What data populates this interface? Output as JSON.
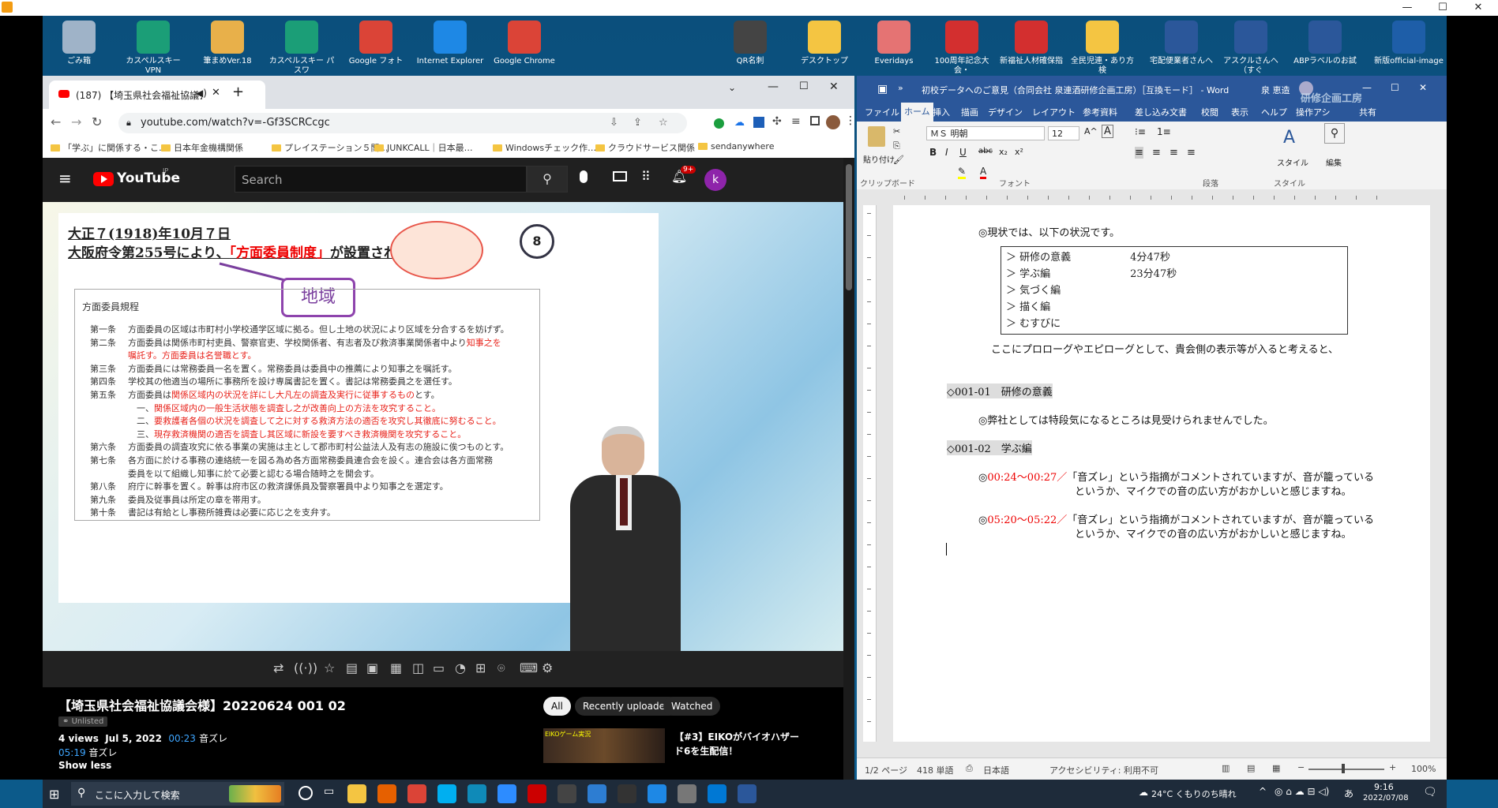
{
  "desktop_icons": [
    {
      "label": "ごみ箱",
      "icon": "recycle-bin-icon",
      "color": "#9fb3c8"
    },
    {
      "label": "カスペルスキー VPN",
      "icon": "vpn-shield-icon",
      "color": "#1b9e77"
    },
    {
      "label": "筆まめVer.18",
      "icon": "fude-document-icon",
      "color": "#e8b04a"
    },
    {
      "label": "カスペルスキー パスワ",
      "icon": "password-shield-icon",
      "color": "#1b9e77"
    },
    {
      "label": "Google フォト",
      "icon": "chrome-icon",
      "color": "#db4437"
    },
    {
      "label": "Internet Explorer",
      "icon": "ie-icon",
      "color": "#1e88e5"
    },
    {
      "label": "Google Chrome",
      "icon": "chrome-icon",
      "color": "#db4437"
    },
    {
      "label": "QR名刺",
      "icon": "qr-code-icon",
      "color": "#444"
    },
    {
      "label": "デスクトップ",
      "icon": "folder-icon",
      "color": "#f4c542"
    },
    {
      "label": "Everidays",
      "icon": "everidays-icon",
      "color": "#e57373"
    },
    {
      "label": "100周年記念大会・",
      "icon": "pdf-icon",
      "color": "#d32f2f"
    },
    {
      "label": "新福祉人材確保指",
      "icon": "pdf-icon",
      "color": "#d32f2f"
    },
    {
      "label": "全民児連・あり方検",
      "icon": "document-icon",
      "color": "#f4c542"
    },
    {
      "label": "宅配便業者さんへ",
      "icon": "word-doc-icon",
      "color": "#2b579a"
    },
    {
      "label": "アスクルさんへ（すぐ",
      "icon": "word-doc-icon",
      "color": "#2b579a"
    },
    {
      "label": "ABPラベルのお試",
      "icon": "word-doc-icon",
      "color": "#2b579a"
    },
    {
      "label": "新版official-image",
      "icon": "image-icon",
      "color": "#1e5ea8"
    }
  ],
  "chrome": {
    "tab_title": "(187) 【埼玉県社会福祉協議会",
    "url": "youtube.com/watch?v=-Gf3SCRCcgc",
    "bookmarks": [
      "「学ぶ」に関係する・こ…",
      "日本年金機構関係",
      "プレイステーション５関…",
      "JUNKCALL｜日本最…",
      "Windowsチェック作…",
      "クラウドサービス関係",
      "sendanywhere"
    ],
    "youtube": {
      "logo": "YouTube",
      "region": "JP",
      "search_placeholder": "Search",
      "notif_count": "9+",
      "avatar_letter": "k"
    },
    "slide": {
      "line1": "大正７(1918)年10月７日",
      "line2_pre": "大阪府令第255号により、",
      "line2_red": "「方面委員制度」",
      "line2_post": "が設置された日",
      "badge": "地域",
      "number": "8",
      "box_title": "方面委員規程",
      "articles": [
        {
          "head": "第一条",
          "text": "方面委員の区域は市町村小学校通学区域に拠る。但し土地の状況により区域を分合するを妨げず。"
        },
        {
          "head": "第二条",
          "text": "方面委員は関係市町村吏員、警察官吏、学校関係者、有志者及び救済事業関係者中より",
          "red": "知事之を"
        },
        {
          "head": "",
          "text": "",
          "red": "嘱託す。方面委員は名誉職とす。"
        },
        {
          "head": "第三条",
          "text": "方面委員には常務委員一名を置く。常務委員は委員中の推薦により知事之を嘱託す。"
        },
        {
          "head": "第四条",
          "text": "学校其の他適当の場所に事務所を設け専属書記を置く。書記は常務委員之を選任す。"
        },
        {
          "head": "第五条",
          "text": "方面委員は",
          "red": "関係区域内の状況を詳にし大凡左の調査及実行に従事するもの",
          "tail": "とす。"
        },
        {
          "head": "",
          "text": "　一、",
          "red": "関係区域内の一般生活状態を調査し之が改善向上の方法を攻究すること。"
        },
        {
          "head": "",
          "text": "　二、",
          "red": "要救護者各個の状況を調査して之に対する救済方法の適否を攻究し其徹底に努むること。"
        },
        {
          "head": "",
          "text": "　三、",
          "red": "現存救済機関の適否を調査し其区域に新設を要すべき救済機関を攻究すること。"
        },
        {
          "head": "第六条",
          "text": "方面委員の調査攻究に依る事業の実施は主として郡市町村公益法人及有志の施設に俟つものとす。"
        },
        {
          "head": "第七条",
          "text": "各方面に於ける事務の連絡統一を図る為め各方面常務委員連合会を設く。連合会は各方面常務"
        },
        {
          "head": "",
          "text": "委員を以て組織し知事に於て必要と認むる場合随時之を開会す。"
        },
        {
          "head": "第八条",
          "text": "府庁に幹事を置く。幹事は府市区の救済課係員及警察署員中より知事之を選定す。"
        },
        {
          "head": "第九条",
          "text": "委員及従事員は所定の章を帯用す。"
        },
        {
          "head": "第十条",
          "text": "書記は有給とし事務所雑費は必要に応じ之を支弁す。"
        }
      ]
    },
    "video_info": {
      "title": "【埼玉県社会福祉協議会様】20220624 001 02",
      "visibility": "Unlisted",
      "views": "4 views",
      "date": "Jul 5, 2022",
      "ts1": "00:23",
      "ts1_text": "音ズレ",
      "ts2": "05:19",
      "ts2_text": "音ズレ",
      "show_less": "Show less"
    },
    "chips": [
      "All",
      "Recently uploaded",
      "Watched"
    ],
    "rec": {
      "title_line1": "【#3】EIKOがバイオハザー",
      "title_line2": "ド6を生配信！",
      "thumb_text": "EIKOゲーム実況"
    }
  },
  "word": {
    "title": "初校データへのご意見（合同会社 泉連酒研修企画工房）［互換モード］ - Word",
    "user": "泉 恵造",
    "overlay_text": "研修企画工房",
    "tabs": [
      "ファイル",
      "ホーム",
      "挿入",
      "描画",
      "デザイン",
      "レイアウト",
      "参考資料",
      "差し込み文書",
      "校閲",
      "表示",
      "ヘルプ",
      "操作アシ",
      "共有"
    ],
    "font_name": "ＭＳ 明朝",
    "font_size": "12",
    "group_labels": [
      "クリップボード",
      "フォント",
      "段落",
      "スタイル"
    ],
    "paste_label": "貼り付け",
    "style_label": "スタイル",
    "edit_label": "編集",
    "doc": {
      "intro": "◎現状では、以下の状況です。",
      "table": [
        {
          "name": "研修の意義",
          "time": "4分47秒"
        },
        {
          "name": "学ぶ編",
          "time": "23分47秒"
        },
        {
          "name": "気づく編",
          "time": ""
        },
        {
          "name": "描く編",
          "time": ""
        },
        {
          "name": "むすびに",
          "time": ""
        }
      ],
      "prologue": "ここにプロローグやエピローグとして、貴会側の表示等が入ると考えると、",
      "sec1": "◇001-01　研修の意義",
      "sec1_text": "◎弊社としては特段気になるところは見受けられませんでした。",
      "sec2": "◇001-02　学ぶ編",
      "note1_red": "00:24～00:27／",
      "note1_text": "「音ズレ」という指摘がコメントされていますが、音が籠っている",
      "note1_cont": "というか、マイクでの音の広い方がおかしいと感じますね。",
      "note2_red": "05:20～05:22／",
      "note2_text": "「音ズレ」という指摘がコメントされていますが、音が籠っている",
      "note2_cont": "というか、マイクでの音の広い方がおかしいと感じますね。"
    },
    "status": {
      "page": "1/2 ページ",
      "words": "418 単語",
      "lang": "日本語",
      "access": "アクセシビリティ: 利用不可",
      "zoom": "100%"
    }
  },
  "taskbar": {
    "search_placeholder": "ここに入力して検索",
    "weather": "24°C  くもりのち晴れ",
    "ime": "あ",
    "time": "9:16",
    "date": "2022/07/08"
  }
}
